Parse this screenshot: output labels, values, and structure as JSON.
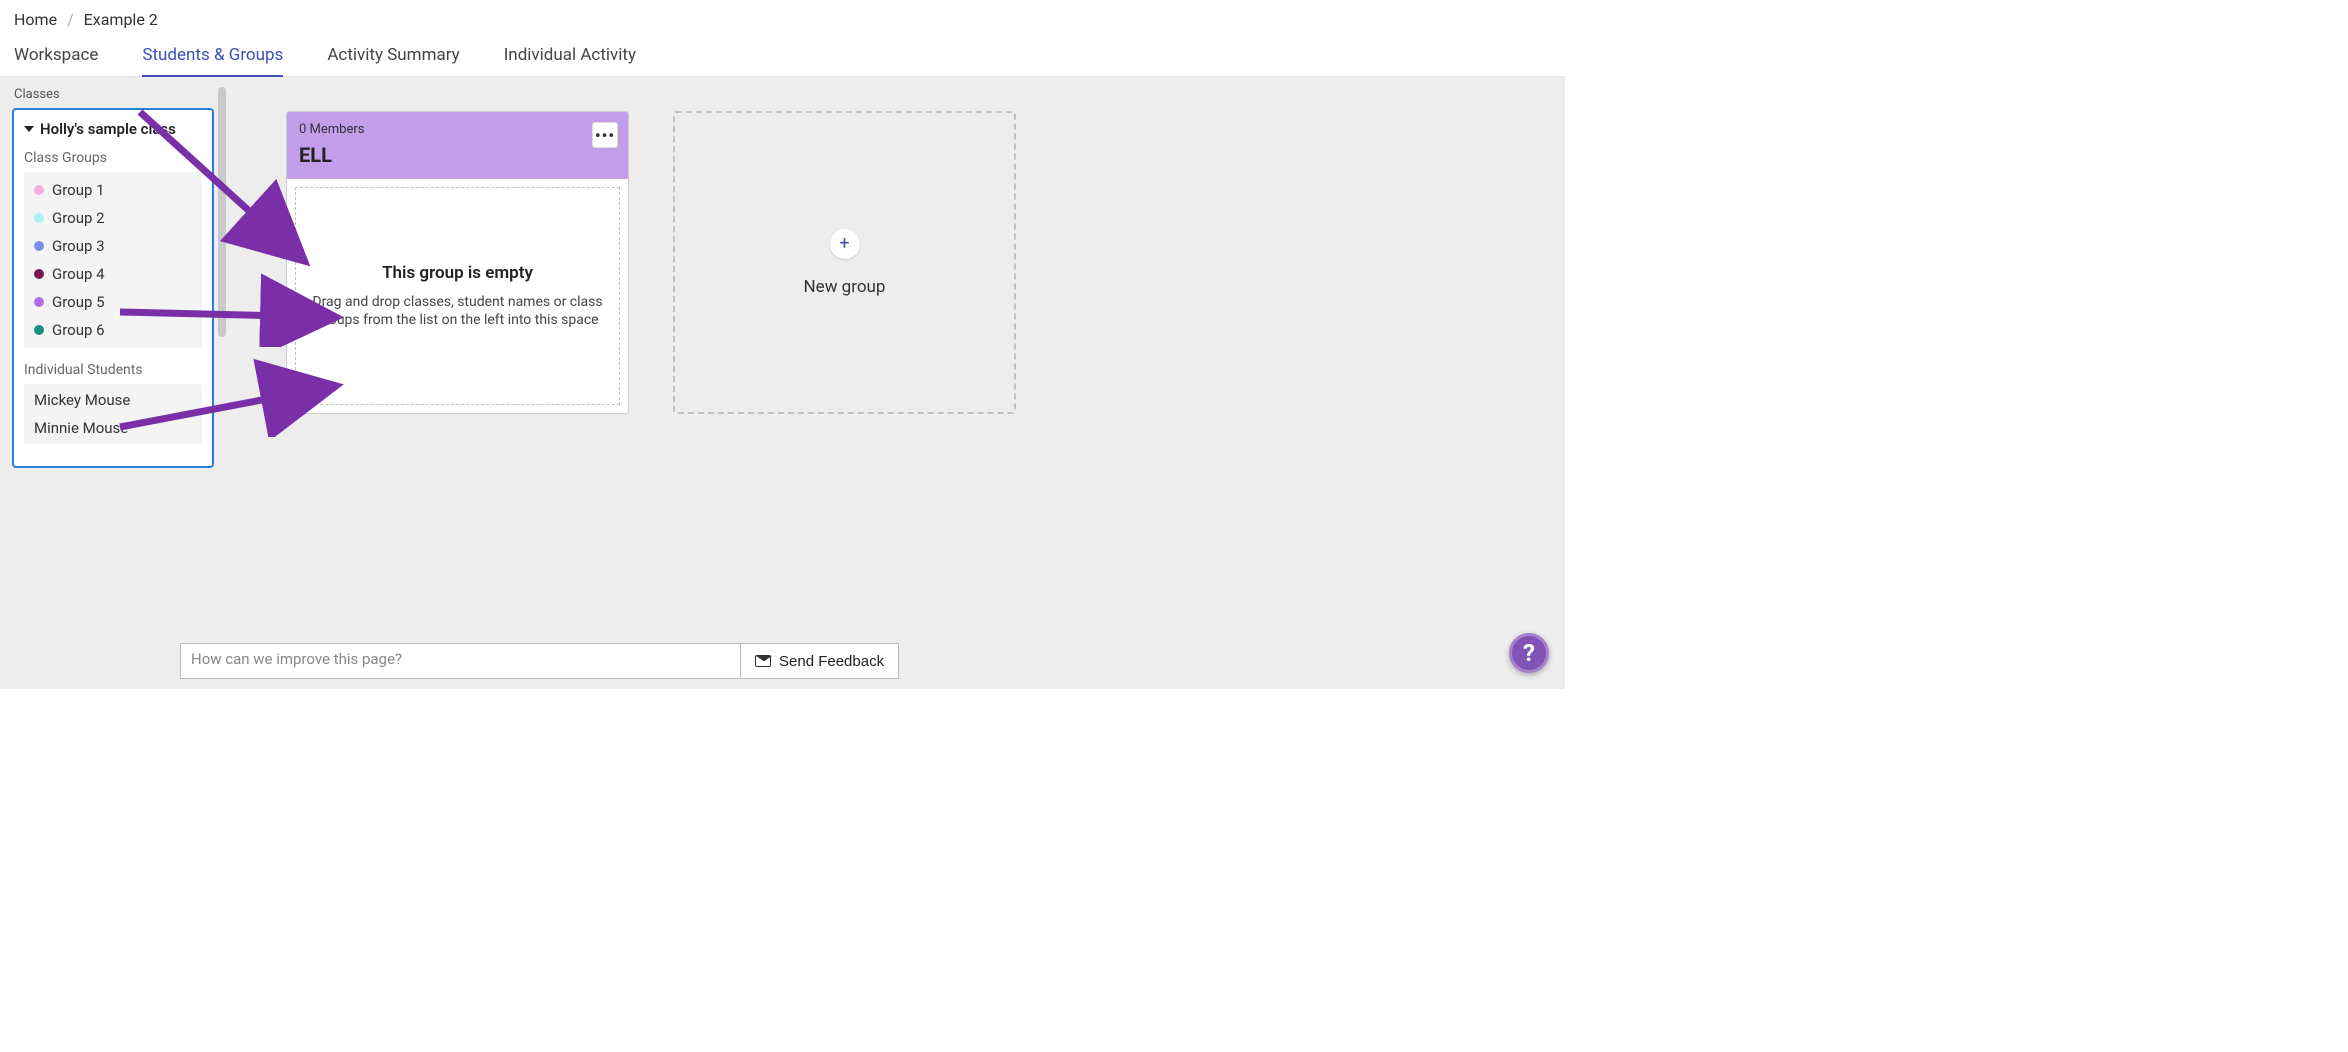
{
  "breadcrumb": {
    "home": "Home",
    "current": "Example 2"
  },
  "tabs": {
    "workspace": "Workspace",
    "students_groups": "Students & Groups",
    "activity_summary": "Activity Summary",
    "individual_activity": "Individual Activity"
  },
  "sidebar": {
    "title": "Classes",
    "class_name": "Holly's sample class",
    "class_groups_label": "Class Groups",
    "groups": [
      {
        "label": "Group 1",
        "color": "#f6aee0"
      },
      {
        "label": "Group 2",
        "color": "#a8f2f2"
      },
      {
        "label": "Group 3",
        "color": "#7a8de8"
      },
      {
        "label": "Group 4",
        "color": "#7a1650"
      },
      {
        "label": "Group 5",
        "color": "#b06ee8"
      },
      {
        "label": "Group 6",
        "color": "#1a8d7e"
      }
    ],
    "individual_students_label": "Individual Students",
    "students": [
      {
        "name": "Mickey Mouse"
      },
      {
        "name": "Minnie Mouse"
      }
    ]
  },
  "group_card": {
    "member_count": "0 Members",
    "name": "ELL",
    "empty_title": "This group is empty",
    "empty_sub": "Drag and drop classes, student names or class groups from the list on the left into this space",
    "header_color": "#c19dea"
  },
  "new_group": {
    "label": "New group"
  },
  "feedback": {
    "placeholder": "How can we improve this page?",
    "button": "Send Feedback"
  },
  "help": {
    "glyph": "?"
  }
}
